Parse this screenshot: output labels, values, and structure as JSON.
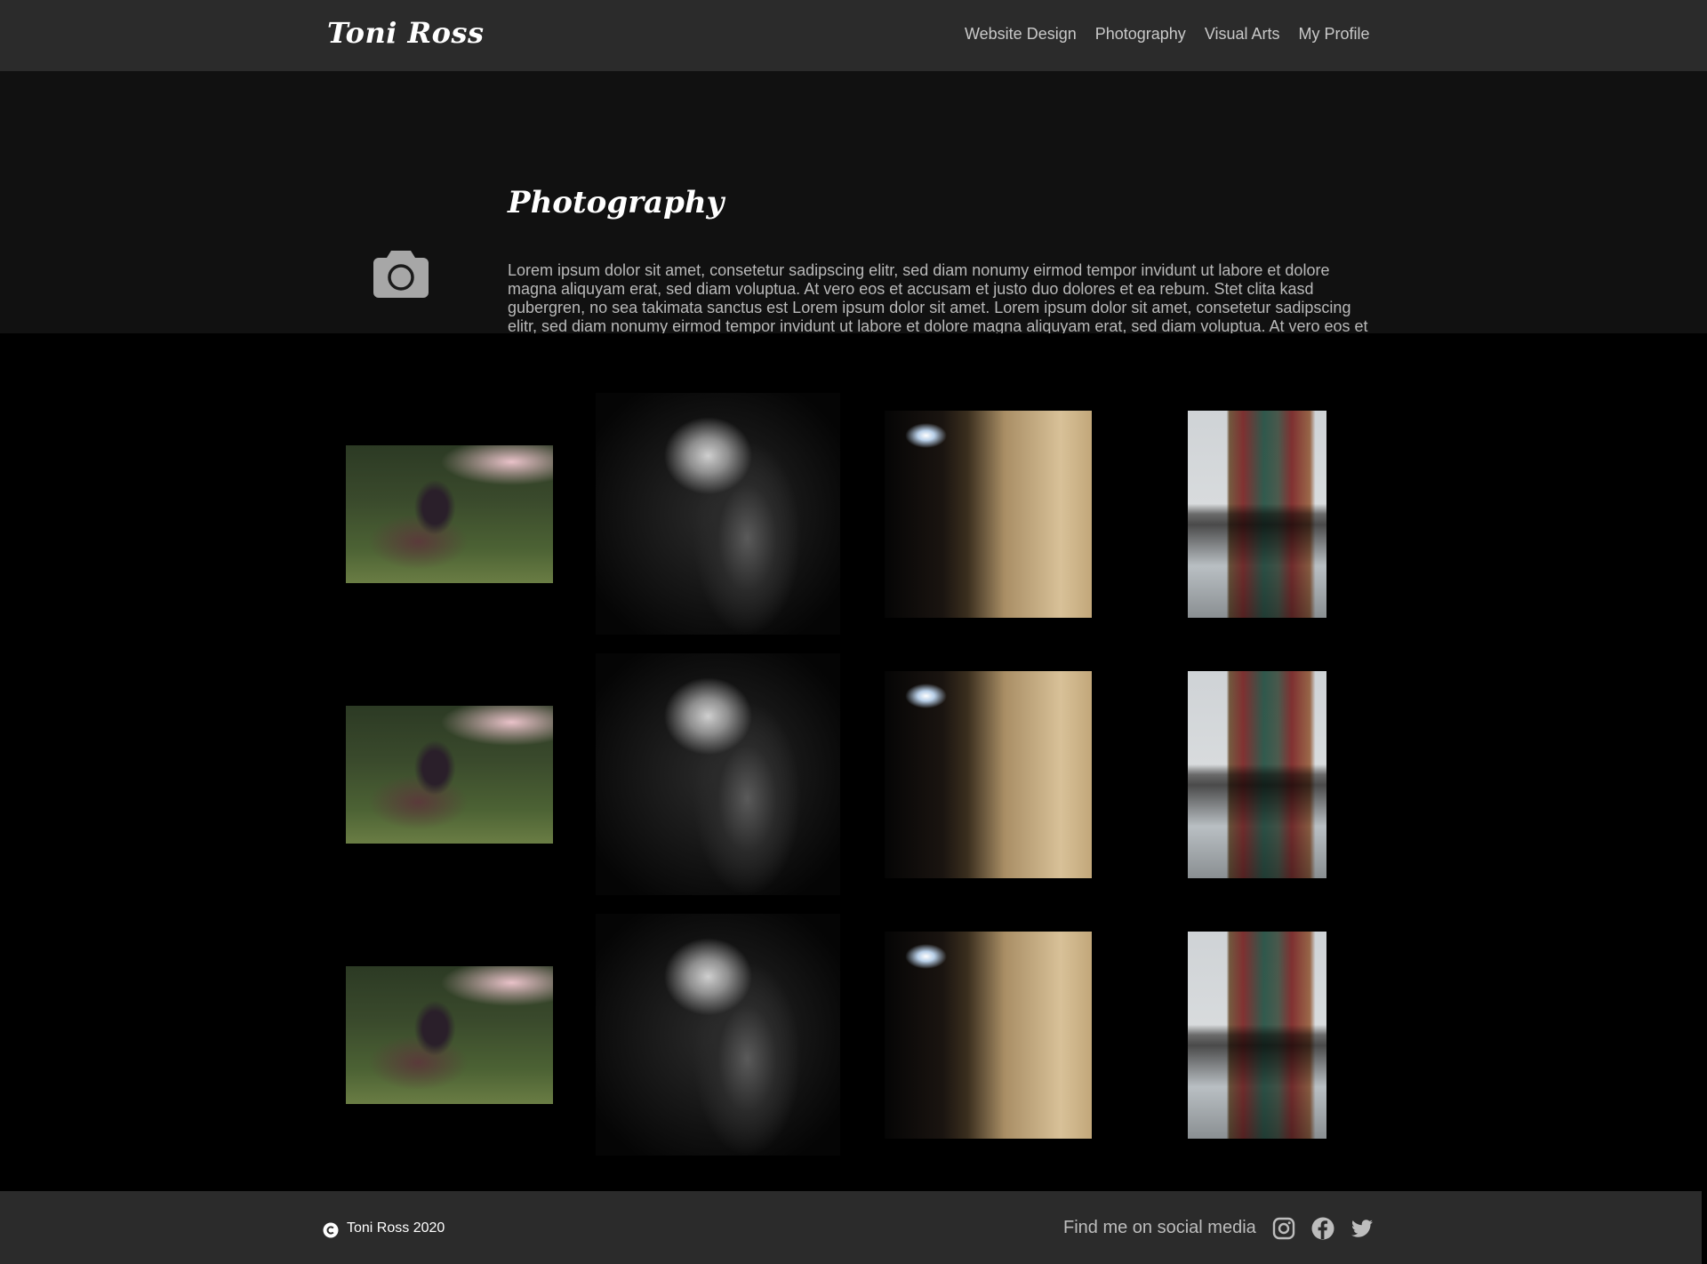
{
  "header": {
    "brand": "Toni Ross",
    "nav": [
      "Website Design",
      "Photography",
      "Visual Arts",
      "My Profile"
    ]
  },
  "intro": {
    "icon": "camera-icon",
    "title": "Photography",
    "text": "Lorem ipsum dolor sit amet, consetetur sadipscing elitr, sed diam nonumy eirmod tempor invidunt ut labore et dolore magna aliquyam erat, sed diam voluptua. At vero eos et accusam et justo duo dolores et ea rebum. Stet clita kasd gubergren, no sea takimata sanctus est Lorem ipsum dolor sit amet. Lorem ipsum dolor sit amet, consetetur sadipscing elitr, sed diam nonumy eirmod tempor invidunt ut labore et dolore magna aliquyam erat, sed diam voluptua. At vero eos et accusam et justo duo dolores et ea rebum. Stet clita kasd gubergren, no sea takimata sanctus est Lorem ipsum dolor"
  },
  "gallery": {
    "rows": 3,
    "photo_kinds": [
      "forest-portrait",
      "bicycle",
      "tunnel",
      "building-reflection"
    ]
  },
  "footer": {
    "copyright": "Toni Ross 2020",
    "social_text": "Find me on social media",
    "social_icons": [
      "instagram-icon",
      "facebook-icon",
      "twitter-icon"
    ]
  },
  "colors": {
    "header_bg": "#2b2b2b",
    "intro_bg": "#111111",
    "gallery_bg": "#000000",
    "accent_text": "#ffffff"
  }
}
